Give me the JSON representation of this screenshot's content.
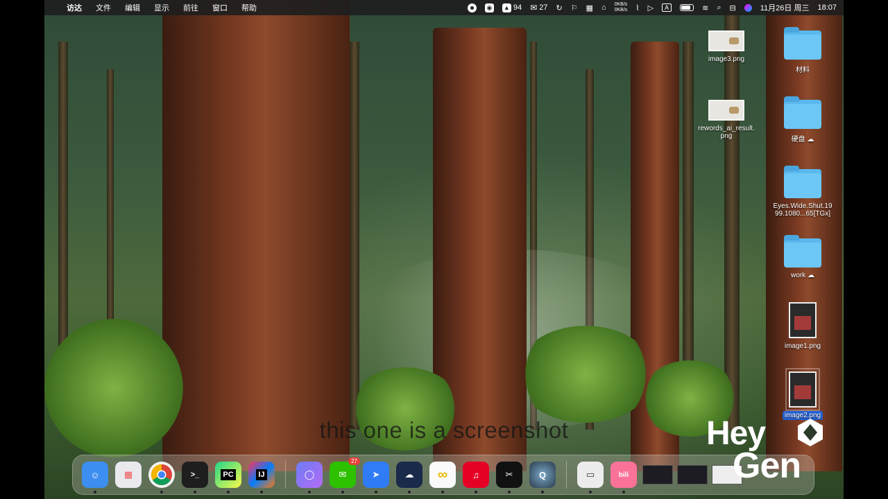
{
  "menubar": {
    "apple_icon": "apple-icon",
    "app_name": "访达",
    "menus": [
      "文件",
      "编辑",
      "显示",
      "前往",
      "窗口",
      "帮助"
    ],
    "status": {
      "badge_94": "94",
      "wechat_count": "27",
      "net_up": "0KB/s",
      "net_down": "0KB/s",
      "input_method": "A",
      "date": "11月26日 周三",
      "time": "18:07"
    }
  },
  "desktop": {
    "icons": [
      {
        "label": "image3.png",
        "type": "image"
      },
      {
        "label": "材料",
        "type": "folder"
      },
      {
        "label": "rewords_ai_result.\npng",
        "type": "image"
      },
      {
        "label": "硬盘 ☁",
        "type": "folder"
      },
      {
        "label": "Eyes.Wide.Shut.19\n99.1080...65[TGx]",
        "type": "folder"
      },
      {
        "label": "work ☁",
        "type": "folder"
      },
      {
        "label": "image1.png",
        "type": "image"
      },
      {
        "label": "image2.png",
        "type": "image",
        "selected": true
      }
    ]
  },
  "subtitle": "this one is a screenshot",
  "watermark": {
    "line1": "Hey",
    "line2": "Gen"
  },
  "dock": {
    "items": [
      {
        "name": "finder",
        "icon": "finder-icon",
        "color": "#3c8ef0",
        "glyph": "☺"
      },
      {
        "name": "launchpad",
        "icon": "launchpad-icon",
        "color": "#e9e9ee",
        "glyph": "▦"
      },
      {
        "name": "chrome",
        "icon": "chrome-icon",
        "color": "#f2f2f2",
        "glyph": "◎"
      },
      {
        "name": "terminal",
        "icon": "terminal-icon",
        "color": "#1e1e1e",
        "glyph": ">_"
      },
      {
        "name": "pycharm",
        "icon": "pycharm-icon",
        "color": "#21d789",
        "glyph": "PC"
      },
      {
        "name": "intellij",
        "icon": "intellij-icon",
        "color": "#d63384",
        "glyph": "IJ"
      },
      {
        "name": "arc",
        "icon": "arc-icon",
        "color": "#6c7cf5",
        "glyph": "◯"
      },
      {
        "name": "wechat",
        "icon": "wechat-icon",
        "color": "#2dc100",
        "glyph": "✉",
        "badge": "27"
      },
      {
        "name": "feishu",
        "icon": "feishu-icon",
        "color": "#2f7cf6",
        "glyph": "➤"
      },
      {
        "name": "qq",
        "icon": "qq-icon",
        "color": "#1a2a4a",
        "glyph": "☁"
      },
      {
        "name": "qqbrowser",
        "icon": "browser-icon",
        "color": "#fafafa",
        "glyph": "∞"
      },
      {
        "name": "netease-music",
        "icon": "music-icon",
        "color": "#e60026",
        "glyph": "♫"
      },
      {
        "name": "capcut",
        "icon": "capcut-icon",
        "color": "#111111",
        "glyph": "✂"
      },
      {
        "name": "quicktime",
        "icon": "quicktime-icon",
        "color": "#4a5a6a",
        "glyph": "Q"
      },
      {
        "name": "preview",
        "icon": "preview-icon",
        "color": "#ececec",
        "glyph": "▭"
      },
      {
        "name": "bilibili",
        "icon": "bilibili-icon",
        "color": "#fb7299",
        "glyph": "bili"
      }
    ]
  }
}
